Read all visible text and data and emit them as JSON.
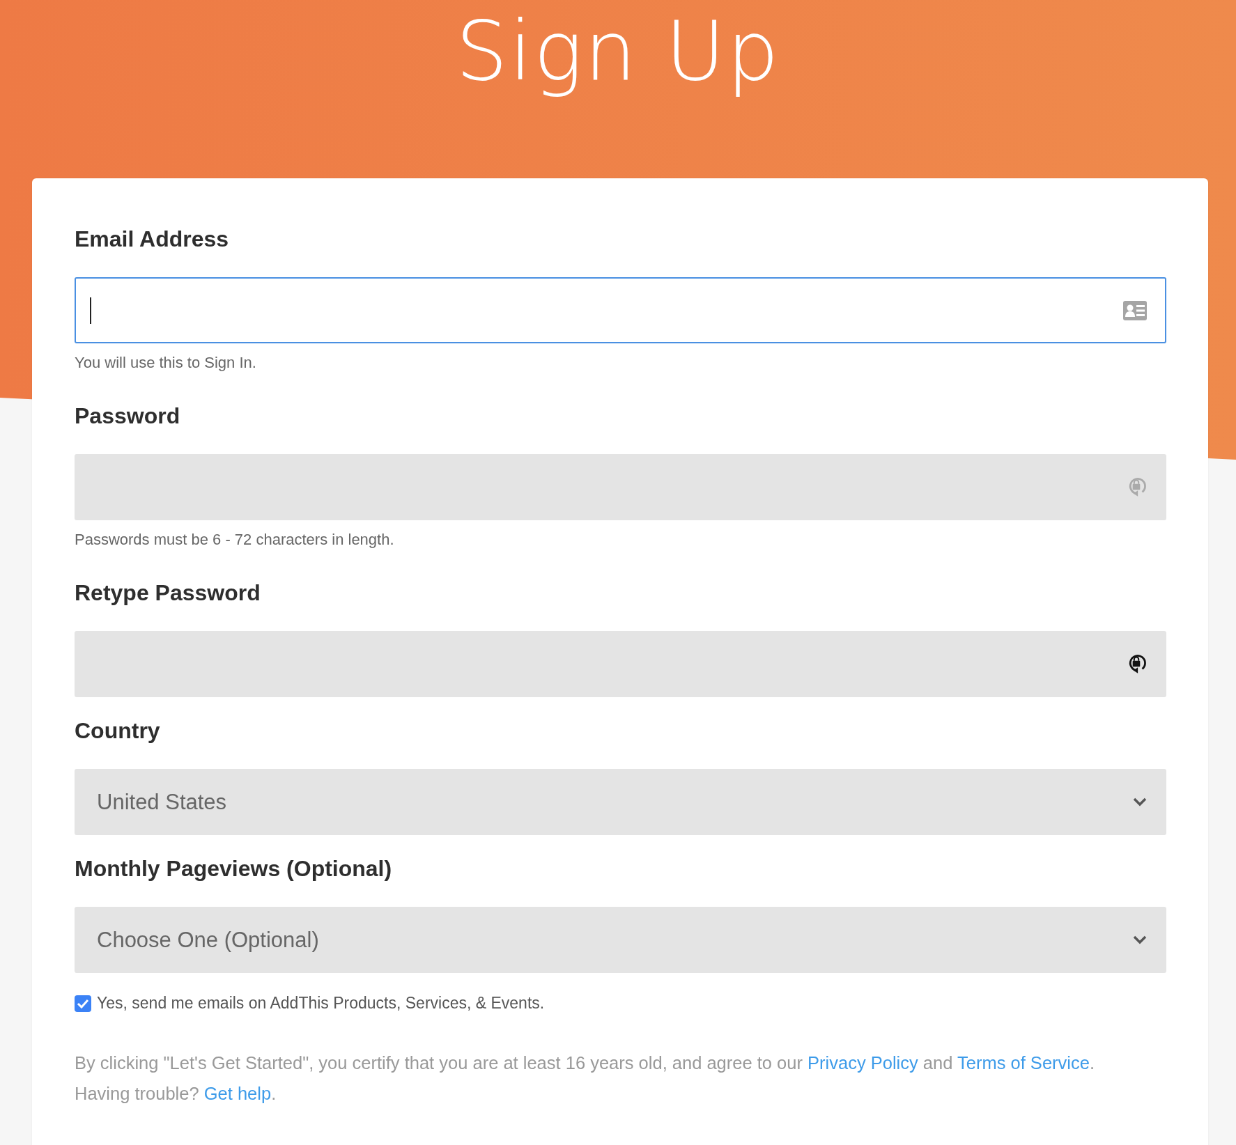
{
  "header": {
    "title": "Sign Up"
  },
  "fields": [
    {
      "kind": "text",
      "label": "Email Address",
      "focused": true,
      "hint": "You will use this to Sign In."
    },
    {
      "kind": "password",
      "label": "Password",
      "focused": false,
      "icon_dark": false,
      "hint": "Passwords must be 6 - 72 characters in length."
    },
    {
      "kind": "password",
      "label": "Retype Password",
      "focused": false,
      "icon_dark": true
    },
    {
      "kind": "select",
      "label": "Country",
      "value": "United States"
    },
    {
      "kind": "select",
      "label": "Monthly Pageviews (Optional)",
      "value": "Choose One (Optional)"
    }
  ],
  "newsletter": {
    "label": "Yes, send me emails on AddThis Products, Services, & Events.",
    "checked": true
  },
  "legal": {
    "text": "By clicking \"Let's Get Started\", you certify that you are at least 16 years old, and agree to our",
    "privacy_link": "Privacy Policy",
    "and": "and",
    "terms_link": "Terms of Service",
    "period": ".",
    "trouble": "Having trouble?",
    "help_link": "Get help",
    "end": "."
  }
}
